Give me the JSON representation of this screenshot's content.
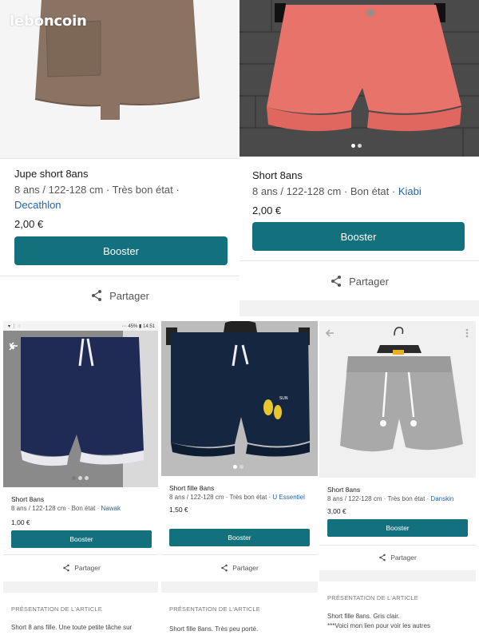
{
  "logo": "leboncoin",
  "colors": {
    "accent": "#13707d",
    "brand_link": "#2563a8"
  },
  "listings": [
    {
      "title": "Jupe short 8ans",
      "meta": "8 ans / 122-128 cm · Très bon état ·",
      "brand": "Decathlon",
      "price": "2,00 €",
      "booster": "Booster",
      "share": "Partager"
    },
    {
      "title": "Short 8ans",
      "meta": "8 ans / 122-128 cm · Bon état ·",
      "brand": "Kiabi",
      "price": "2,00 €",
      "booster": "Booster",
      "share": "Partager"
    },
    {
      "status_left": "▾ ⋮ ◌",
      "status_right": "⋯ 45% ▮ 14:51",
      "title": "Short 8ans",
      "meta": "8 ans / 122-128 cm · Bon état ·",
      "brand": "Nawak",
      "price": "1,00 €",
      "booster": "Booster",
      "share": "Partager",
      "section": "PRÉSENTATION DE L'ARTICLE",
      "description": "Short 8 ans fille. Une toute petite tâche sur"
    },
    {
      "title": "Short fille 8ans",
      "meta": "8 ans / 122-128 cm · Très bon état ·",
      "brand": "U Essentiel",
      "price": "1,50 €",
      "booster": "Booster",
      "share": "Partager",
      "section": "PRÉSENTATION DE L'ARTICLE",
      "description": "Short fille 8ans. Très peu porté."
    },
    {
      "title": "Short 8ans",
      "meta": "8 ans / 122-128 cm · Très bon état ·",
      "brand": "Danskin",
      "price": "3,00 €",
      "booster": "Booster",
      "share": "Partager",
      "section": "PRÉSENTATION DE L'ARTICLE",
      "description": "Short fille 8ans. Gris clair.",
      "description2": "***Voici mon lien pour voir les autres"
    }
  ]
}
